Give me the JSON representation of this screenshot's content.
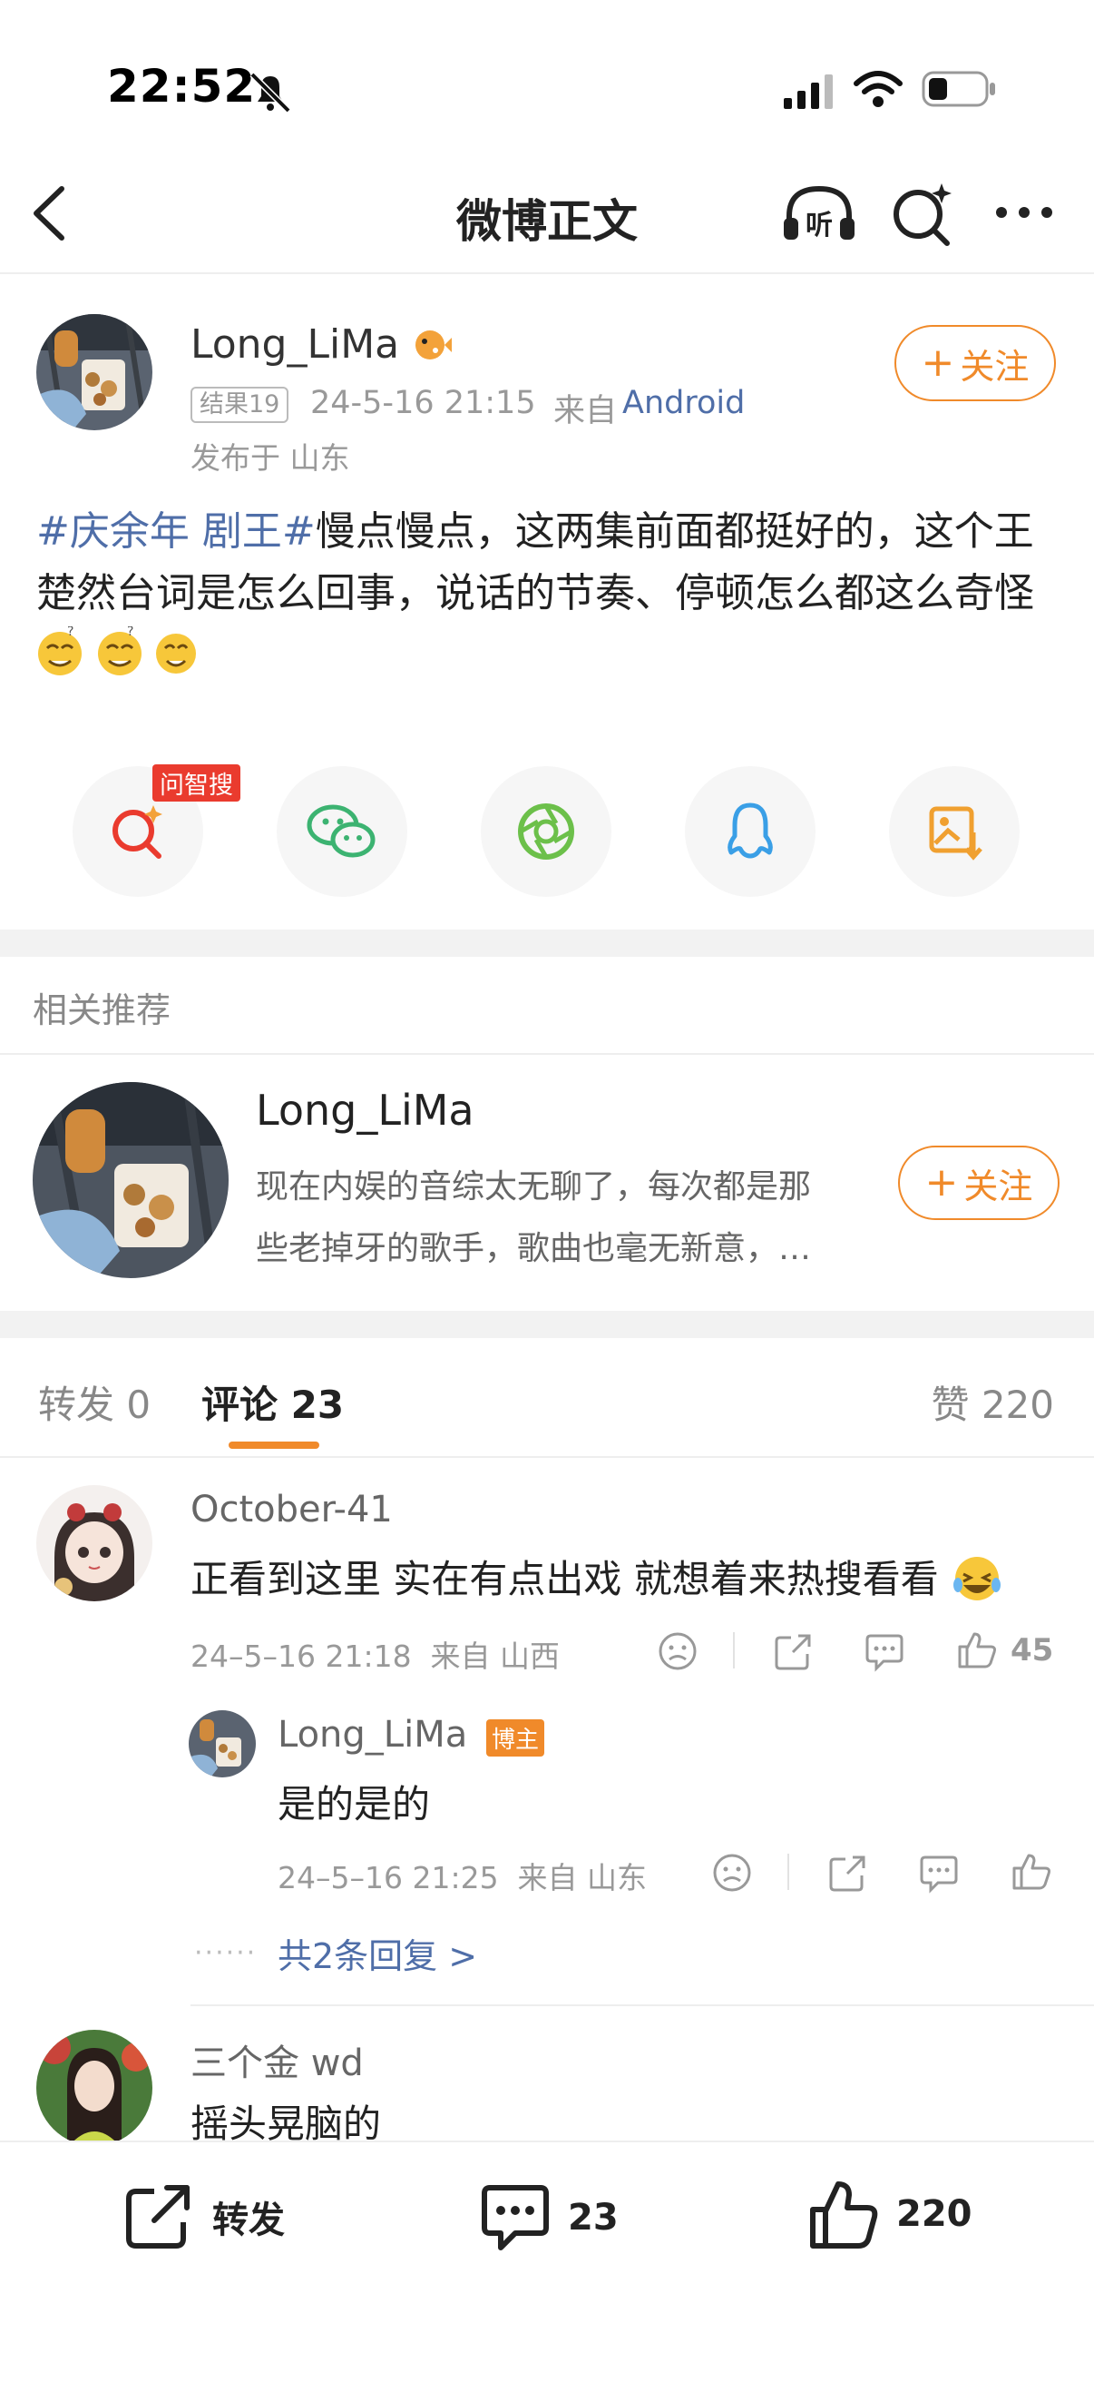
{
  "status_bar": {
    "time": "22:52"
  },
  "nav": {
    "title": "微博正文"
  },
  "post": {
    "author": "Long_LiMa",
    "badge": "结果19",
    "time": "24-5-16 21:15",
    "source_prefix": "来自",
    "source": "Android",
    "location": "发布于 山东",
    "follow_label": "关注",
    "hashtag": "#庆余年 剧王#",
    "text": "慢点慢点，这两集前面都挺好的，这个王楚然台词是怎么回事，说话的节奏、停顿怎么都这么奇怪"
  },
  "share": {
    "search_badge": "问智搜"
  },
  "recommend": {
    "header": "相关推荐",
    "name": "Long_LiMa",
    "desc_line1": "现在内娱的音综太无聊了，每次都是那",
    "desc_line2": "些老掉牙的歌手，歌曲也毫无新意，…",
    "follow_label": "关注"
  },
  "tabs": {
    "repost_label": "转发",
    "repost_count": "0",
    "comment_label": "评论",
    "comment_count": "23",
    "like_label": "赞",
    "like_count": "220"
  },
  "comments": [
    {
      "author": "October-41",
      "text": "正看到这里 实在有点出戏 就想着来热搜看看",
      "meta": "24–5–16 21:18  来自 山西",
      "likes": "45"
    },
    {
      "author": "三个金 wd",
      "text": "摇头晃脑的"
    }
  ],
  "reply": {
    "author": "Long_LiMa",
    "badge": "博主",
    "text": "是的是的",
    "meta": "24–5–16 21:25  来自 山东",
    "more": "共2条回复 >"
  },
  "bottom_bar": {
    "repost_label": "转发",
    "comment_count": "23",
    "like_count": "220"
  },
  "colors": {
    "accent": "#f08a2a",
    "link": "#4f6ea8",
    "badge_red": "#ea3b2e"
  }
}
